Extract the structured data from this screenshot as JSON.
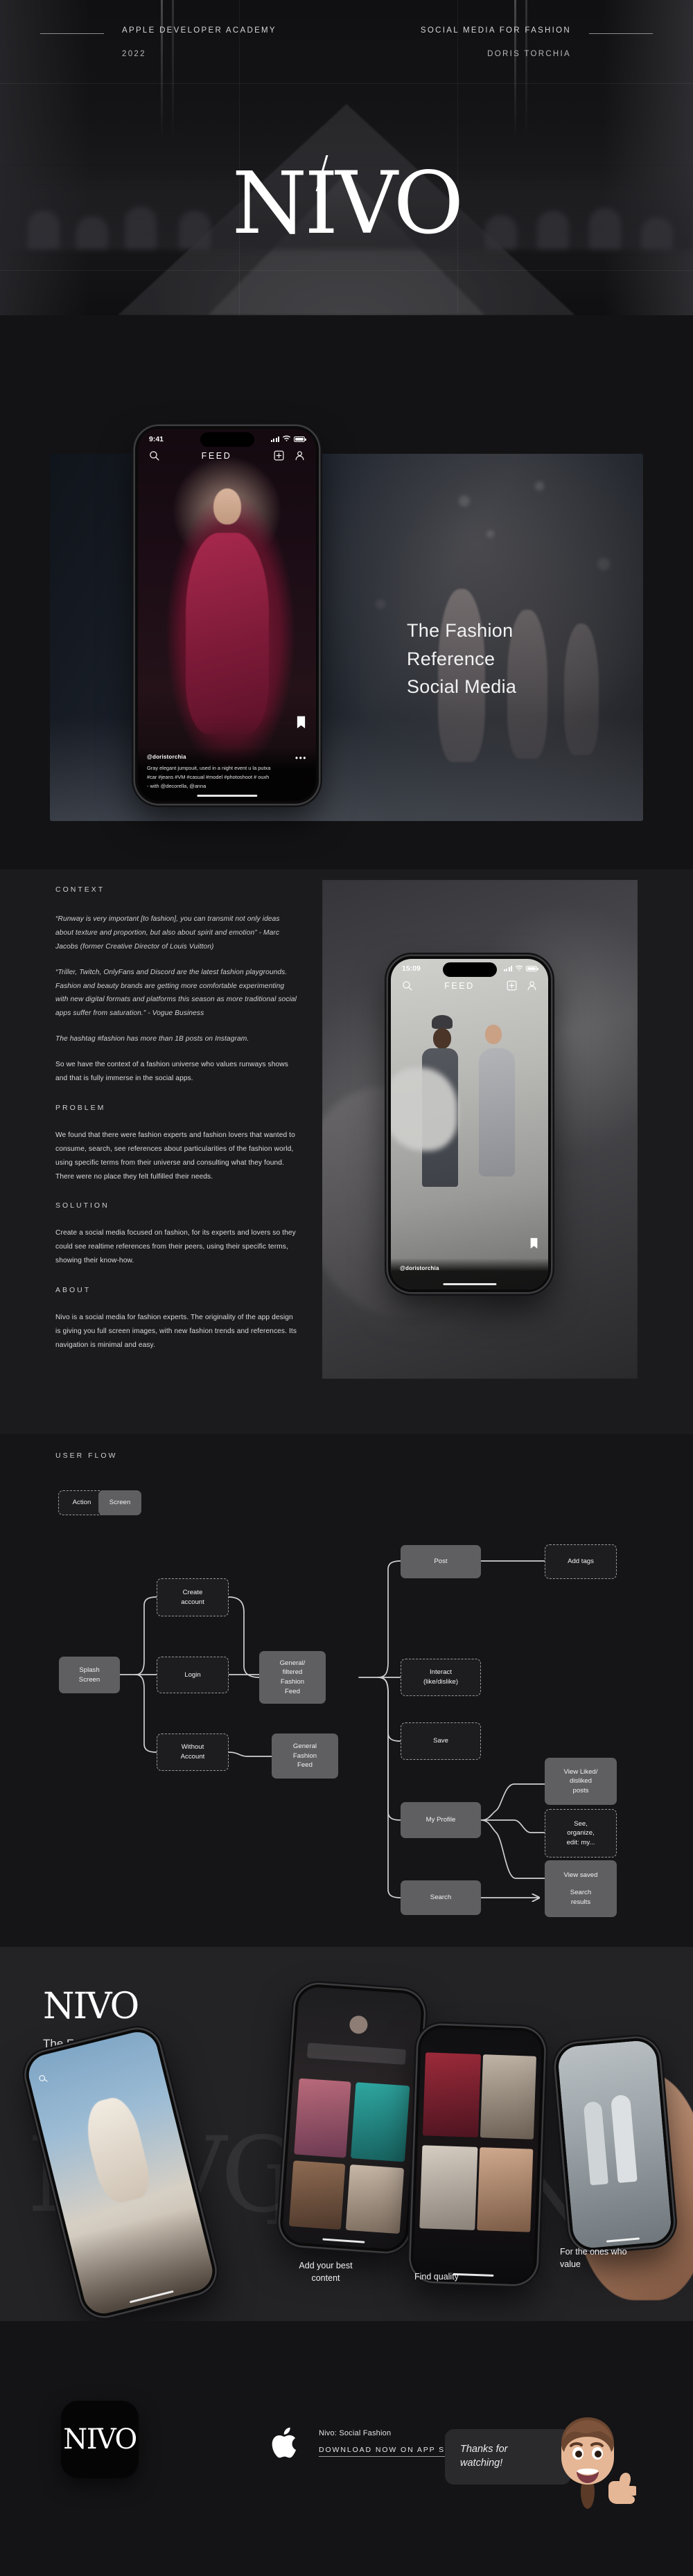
{
  "cover": {
    "left_top": "APPLE DEVELOPER ACADEMY",
    "left_bottom": "2022",
    "right_top": "SOCIAL MEDIA FOR FASHION",
    "right_bottom": "DORIS TORCHIA",
    "logo_pre": "N",
    "logo_acc": "I",
    "logo_post": "VO",
    "logo_full": "NIVO"
  },
  "hero": {
    "headline_line1": "The Fashion",
    "headline_line2": "Reference",
    "headline_line3": "Social Media",
    "phone": {
      "time": "9:41",
      "nav_title": "FEED",
      "search_icon": "search-icon",
      "add_icon": "add-post-icon",
      "profile_icon": "profile-icon",
      "bookmark_icon": "bookmark-icon",
      "more_icon": "more-options-icon",
      "username": "@doristorchia",
      "caption_line1": "Gray elegant jumpsuit, used in a night event u la putxa",
      "caption_line2": "#car  #jeans #VM #casual #model #photoshoot # ouxh",
      "caption_line3": "- with @decorella, @anna"
    }
  },
  "context": {
    "kicker": "CONTEXT",
    "paragraphs": [
      {
        "italic": true,
        "text": "“Runway is very important [to fashion], you can transmit not only ideas about texture and proportion, but also about spirit and emotion” - Marc Jacobs (former Creative Director of Louis Vuitton)"
      },
      {
        "italic": true,
        "text": "“Triller, Twitch, OnlyFans and Discord are the latest fashion playgrounds. Fashion and beauty brands are getting more comfortable experimenting with new digital formats and platforms this season as more traditional social apps suffer from saturation.” - Vogue Business"
      },
      {
        "italic": true,
        "text": "The hashtag #fashion has more than 1B posts on Instagram."
      },
      {
        "italic": false,
        "text": "So we have the context of a fashion universe who values runways shows and that is fully immerse in the social apps."
      }
    ],
    "problem": {
      "kicker": "PROBLEM",
      "text": "We found that there were fashion experts and fashion lovers that wanted to consume, search, see references about particularities of the fashion world, using specific terms from their universe and consulting what they found. There were no place they felt fulfilled their needs."
    },
    "solution": {
      "kicker": "SOLUTION",
      "text": "Create a social media focused on fashion, for its experts and lovers so they could see realtime references from their peers, using their specific terms, showing their know-how."
    },
    "about": {
      "kicker": "ABOUT",
      "text": "Nivo is a social media for fashion experts. The originality of the app design is giving you full screen images, with new fashion trends and references. Its navigation is minimal and easy."
    },
    "phone": {
      "time": "15:09",
      "nav_title": "FEED",
      "username": "@doristorchia"
    }
  },
  "user_flow": {
    "kicker": "USER FLOW",
    "legend": {
      "action": "Action",
      "screen": "Screen"
    },
    "nodes": [
      {
        "id": "splash",
        "label": "Splash\nScreen",
        "type": "screen"
      },
      {
        "id": "create",
        "label": "Create\naccount",
        "type": "action"
      },
      {
        "id": "login",
        "label": "Login",
        "type": "action"
      },
      {
        "id": "without",
        "label": "Without\nAccount",
        "type": "action"
      },
      {
        "id": "filtered-feed",
        "label": "General/\nfiltered\nFashion\nFeed",
        "type": "screen"
      },
      {
        "id": "general-feed",
        "label": "General\nFashion\nFeed",
        "type": "screen"
      },
      {
        "id": "post",
        "label": "Post",
        "type": "screen"
      },
      {
        "id": "interact",
        "label": "Interact\n(like/dislike)",
        "type": "action"
      },
      {
        "id": "save",
        "label": "Save",
        "type": "action"
      },
      {
        "id": "my-profile",
        "label": "My Profile",
        "type": "screen"
      },
      {
        "id": "search",
        "label": "Search",
        "type": "screen"
      },
      {
        "id": "add-tags",
        "label": "Add tags",
        "type": "action"
      },
      {
        "id": "view-liked",
        "label": "View Liked/\ndisliked\nposts",
        "type": "screen"
      },
      {
        "id": "see-organize",
        "label": "See,\norganize,\nedit: my...",
        "type": "action"
      },
      {
        "id": "view-saved",
        "label": "View saved\nposts",
        "type": "screen"
      },
      {
        "id": "search-results",
        "label": "Search\nresults",
        "type": "screen"
      }
    ]
  },
  "showcase": {
    "logo": "NIVO",
    "tagline": "The Fashion\nReference\nApp",
    "captions": [
      "Add your best\ncontent",
      "Find quality",
      "For the ones who\nvalue"
    ]
  },
  "footer": {
    "app_icon_logo": "NIVO",
    "apple_icon": "apple-logo-icon",
    "app_name": "Nivo: Social Fashion",
    "download_cta": "DOWNLOAD NOW ON APP STORE",
    "thanks": "Thanks for\nwatching!",
    "memoji": "memoji-thumbs-up"
  },
  "colors": {
    "page_bg": "#181818",
    "cover_bg": "#0b0b0c",
    "section_bg_1": "#131315",
    "section_bg_2": "#1b1b1d",
    "section_bg_3": "#151517",
    "section_bg_4": "#232326",
    "footer_bg": "#141416",
    "node_screen": "#5f5f61",
    "node_action_border": "#9a9a9d",
    "text_primary": "#f2f2f3",
    "text_muted": "#cfcfd2"
  }
}
